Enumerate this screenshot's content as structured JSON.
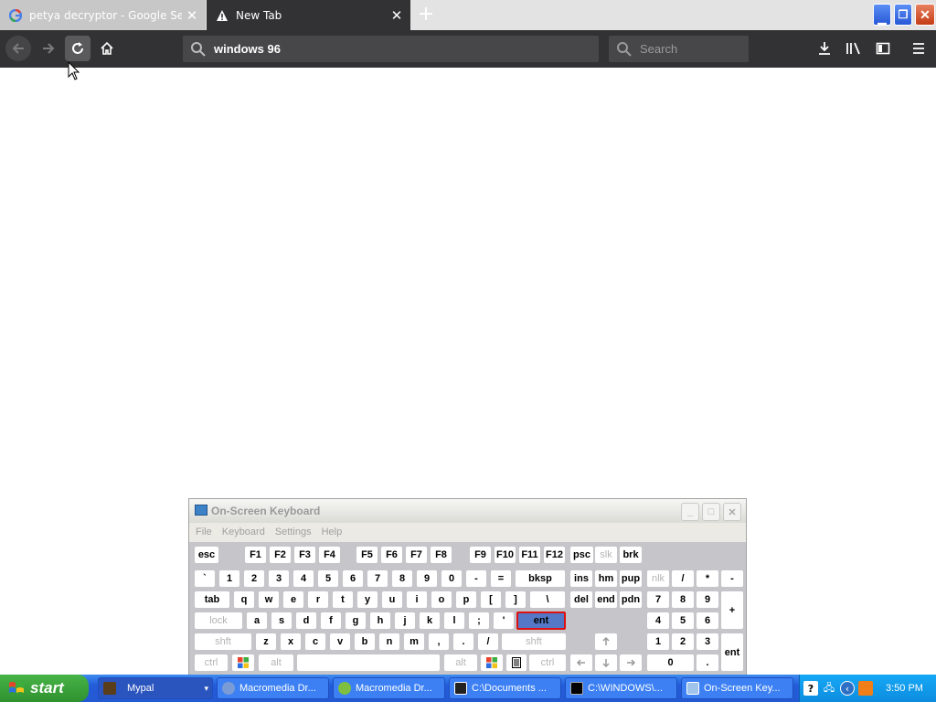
{
  "browser": {
    "tabs": [
      {
        "label": "petya decryptor - Google Search",
        "icon": "google-icon",
        "active": false
      },
      {
        "label": "New Tab",
        "icon": "warning-icon",
        "active": true
      }
    ],
    "url": "windows 96",
    "search_placeholder": "Search",
    "colors": {
      "toolbar": "#323234",
      "tabstrip": "#e3e3e3"
    }
  },
  "osk": {
    "title": "On-Screen Keyboard",
    "menu": [
      "File",
      "Keyboard",
      "Settings",
      "Help"
    ],
    "keys": {
      "esc": "esc",
      "f": [
        "F1",
        "F2",
        "F3",
        "F4",
        "F5",
        "F6",
        "F7",
        "F8",
        "F9",
        "F10",
        "F11",
        "F12"
      ],
      "psc": "psc",
      "slk": "slk",
      "brk": "brk",
      "num_row": [
        "`",
        "1",
        "2",
        "3",
        "4",
        "5",
        "6",
        "7",
        "8",
        "9",
        "0",
        "-",
        "="
      ],
      "bksp": "bksp",
      "tab": "tab",
      "q_row": [
        "q",
        "w",
        "e",
        "r",
        "t",
        "y",
        "u",
        "i",
        "o",
        "p",
        "[",
        "]",
        "\\"
      ],
      "lock": "lock",
      "a_row": [
        "a",
        "s",
        "d",
        "f",
        "g",
        "h",
        "j",
        "k",
        "l",
        ";",
        "'"
      ],
      "ent": "ent",
      "shft": "shft",
      "z_row": [
        "z",
        "x",
        "c",
        "v",
        "b",
        "n",
        "m",
        ",",
        ".",
        "/"
      ],
      "ctrl": "ctrl",
      "alt": "alt",
      "nav": [
        "ins",
        "hm",
        "pup",
        "del",
        "end",
        "pdn"
      ],
      "numpad": {
        "nlk": "nlk",
        "div": "/",
        "mul": "*",
        "minus": "-",
        "plus": "+",
        "r1": [
          "7",
          "8",
          "9"
        ],
        "r2": [
          "4",
          "5",
          "6"
        ],
        "r3": [
          "1",
          "2",
          "3"
        ],
        "zero": "0",
        "dot": ".",
        "ent": "ent"
      }
    }
  },
  "taskbar": {
    "start": "start",
    "tasks": [
      "Mypal",
      "Macromedia Dr...",
      "Macromedia Dr...",
      "C:\\Documents ...",
      "C:\\WINDOWS\\...",
      "On-Screen Key..."
    ],
    "clock": "3:50 PM"
  }
}
